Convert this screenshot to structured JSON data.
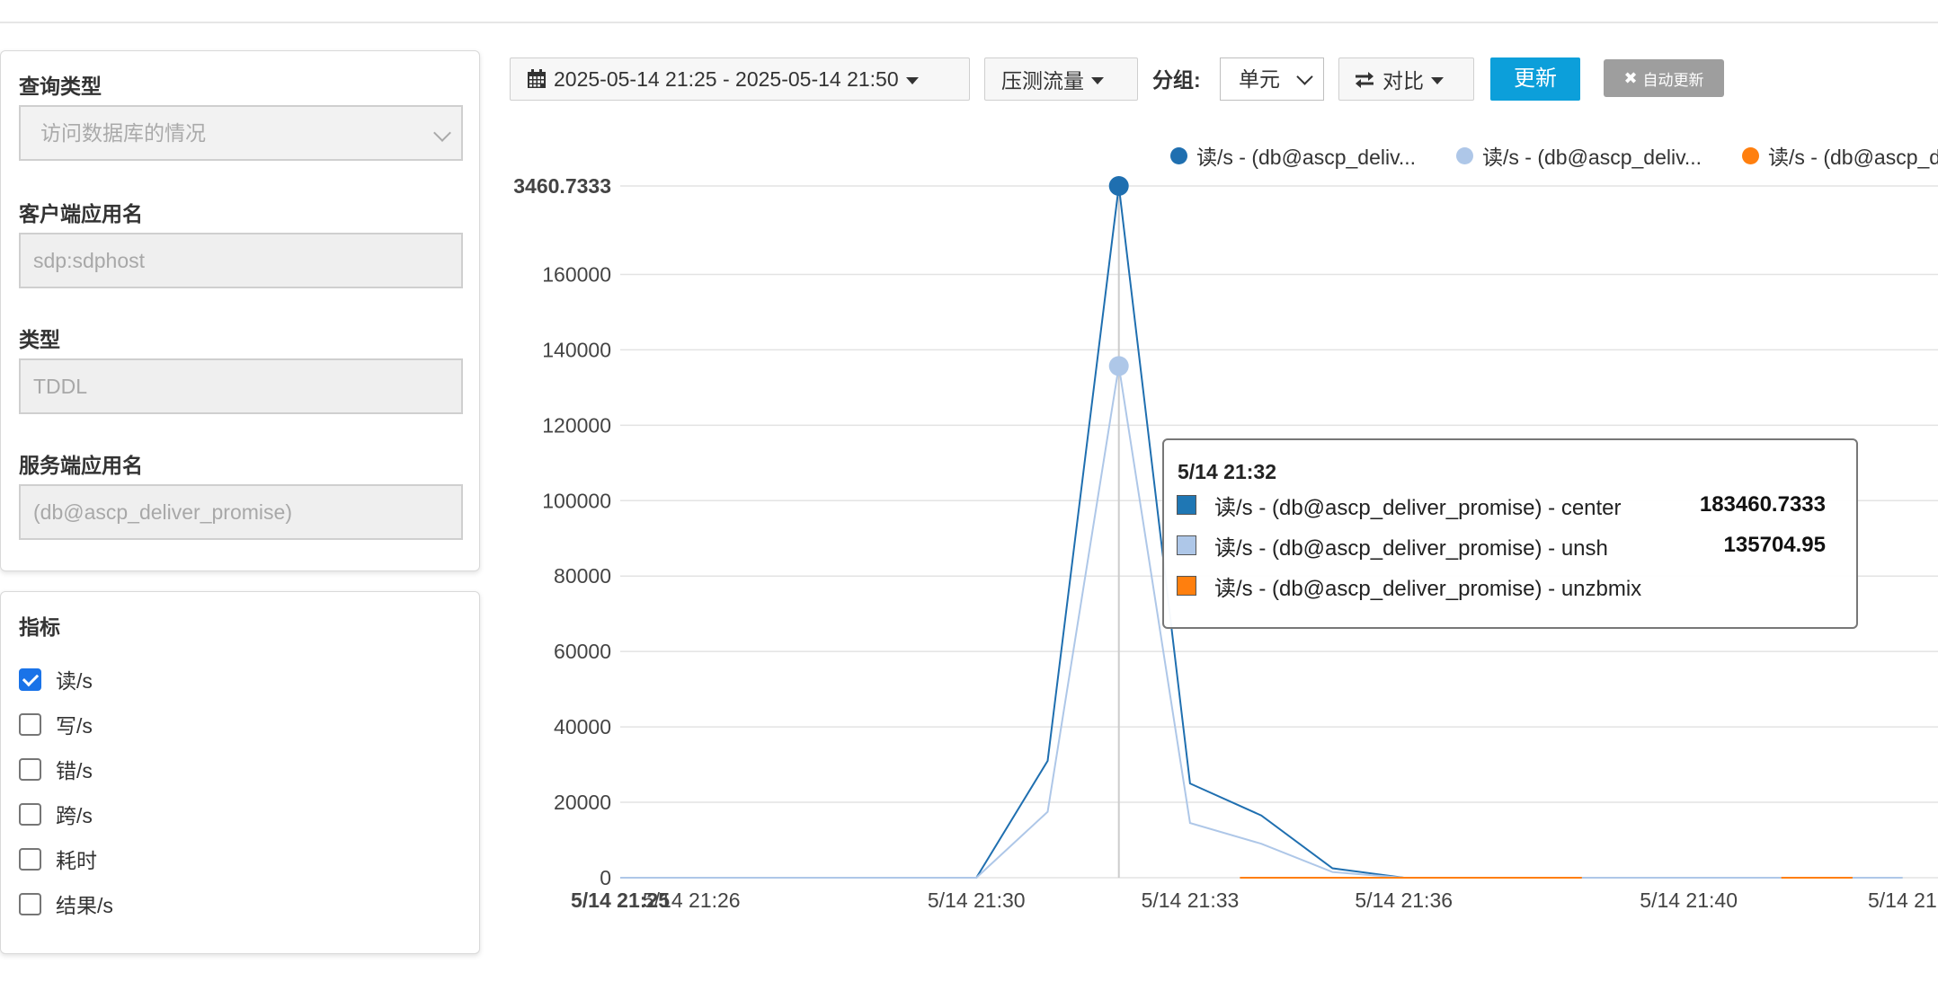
{
  "filters": {
    "query_type": {
      "label": "查询类型",
      "value": "访问数据库的情况"
    },
    "client_app": {
      "label": "客户端应用名",
      "value": "sdp:sdphost"
    },
    "type": {
      "label": "类型",
      "value": "TDDL"
    },
    "server_app": {
      "label": "服务端应用名",
      "value": "(db@ascp_deliver_promise)"
    }
  },
  "metrics": {
    "label": "指标",
    "items": [
      {
        "label": "读/s",
        "checked": true
      },
      {
        "label": "写/s",
        "checked": false
      },
      {
        "label": "错/s",
        "checked": false
      },
      {
        "label": "跨/s",
        "checked": false
      },
      {
        "label": "耗时",
        "checked": false
      },
      {
        "label": "结果/s",
        "checked": false
      }
    ]
  },
  "toolbar": {
    "date_range": "2025-05-14 21:25 - 2025-05-14 21:50",
    "traffic": "压测流量",
    "group_label": "分组:",
    "group_value": "单元",
    "compare": "对比",
    "update": "更新",
    "auto_update": "自动更新"
  },
  "legend": [
    {
      "label": "读/s - (db@ascp_deliv...",
      "color": "#1f6fb0"
    },
    {
      "label": "读/s - (db@ascp_deliv...",
      "color": "#aec7e8"
    },
    {
      "label": "读/s - (db@ascp_d",
      "color": "#ff7f0e"
    }
  ],
  "tooltip": {
    "title": "5/14 21:32",
    "rows": [
      {
        "name": "读/s - (db@ascp_deliver_promise) - center",
        "value": "183460.7333",
        "color": "#1f77b4"
      },
      {
        "name": "读/s - (db@ascp_deliver_promise) - unsh",
        "value": "135704.95",
        "color": "#aec7e8"
      },
      {
        "name": "读/s - (db@ascp_deliver_promise) - unzbmix",
        "value": "",
        "color": "#ff7f0e"
      }
    ]
  },
  "chart_data": {
    "type": "line",
    "top_label": "3460.7333",
    "ylim": [
      0,
      183460.7333
    ],
    "y_ticks": [
      0,
      20000,
      40000,
      60000,
      80000,
      100000,
      120000,
      140000,
      160000
    ],
    "x_tick_labels": [
      {
        "t": 0,
        "label": "5/14 21:25",
        "bold": true
      },
      {
        "t": 1,
        "label": "5/14 21:26"
      },
      {
        "t": 5,
        "label": "5/14 21:30"
      },
      {
        "t": 8,
        "label": "5/14 21:33"
      },
      {
        "t": 11,
        "label": "5/14 21:36"
      },
      {
        "t": 15,
        "label": "5/14 21:40"
      },
      {
        "t": 18,
        "label": "5/14 21"
      }
    ],
    "x_domain": [
      0,
      18.5
    ],
    "hover_t": 7,
    "series": [
      {
        "name": "读/s - (db@ascp_deliver_promise) - center",
        "color": "#1f6fb0",
        "t": [
          0,
          1,
          2,
          3,
          4,
          5,
          6,
          7,
          8,
          9,
          10,
          11,
          12,
          13,
          14,
          15,
          16,
          17,
          18
        ],
        "values": [
          0,
          0,
          0,
          0,
          0,
          0,
          31000,
          183460.7333,
          25000,
          16500,
          2500,
          0,
          0,
          0,
          0,
          0,
          0,
          0,
          0
        ]
      },
      {
        "name": "读/s - (db@ascp_deliver_promise) - unsh",
        "color": "#aec7e8",
        "t": [
          0,
          1,
          2,
          3,
          4,
          5,
          6,
          7,
          8,
          9,
          10,
          11,
          12,
          13,
          14,
          15,
          16,
          17,
          18
        ],
        "values": [
          0,
          0,
          0,
          0,
          0,
          0,
          17500,
          135704.95,
          14500,
          9000,
          1500,
          0,
          0,
          0,
          0,
          0,
          0,
          0,
          0
        ]
      },
      {
        "name": "读/s - (db@ascp_deliver_promise) - unzbmix",
        "color": "#ff7f0e",
        "t": [
          8.7,
          13.5
        ],
        "values": [
          0,
          0
        ],
        "extra_segments": [
          [
            16.3,
            17.3
          ]
        ]
      }
    ]
  }
}
